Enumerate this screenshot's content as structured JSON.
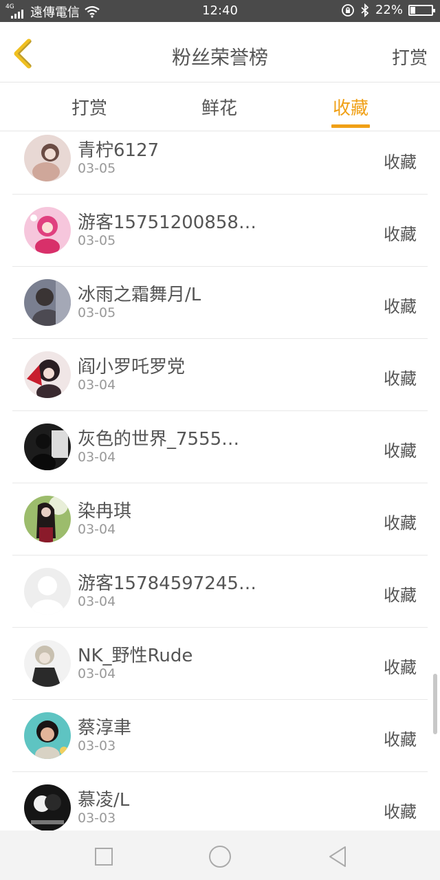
{
  "status_bar": {
    "network": "4G",
    "carrier": "遠傳電信",
    "time": "12:40",
    "battery_text": "22%",
    "battery_level": 0.22
  },
  "header": {
    "title": "粉丝荣誉榜",
    "right_label": "打赏"
  },
  "tabs": [
    {
      "label": "打赏",
      "active": false
    },
    {
      "label": "鲜花",
      "active": false
    },
    {
      "label": "收藏",
      "active": true
    }
  ],
  "colors": {
    "accent": "#f0a016",
    "text": "#555555",
    "subtext": "#999999",
    "status_bar": "#4a4a4a"
  },
  "fans": [
    {
      "name": "青柠6127",
      "date": "03-05",
      "action": "收藏"
    },
    {
      "name": "游客15751200858…",
      "date": "03-05",
      "action": "收藏"
    },
    {
      "name": "冰雨之霜舞月/L",
      "date": "03-05",
      "action": "收藏"
    },
    {
      "name": "阎小罗吒罗党",
      "date": "03-04",
      "action": "收藏"
    },
    {
      "name": "灰色的世界_7555…",
      "date": "03-04",
      "action": "收藏"
    },
    {
      "name": "染冉琪",
      "date": "03-04",
      "action": "收藏"
    },
    {
      "name": "游客15784597245…",
      "date": "03-04",
      "action": "收藏"
    },
    {
      "name": "NK_野性Rude",
      "date": "03-04",
      "action": "收藏"
    },
    {
      "name": "蔡淳聿",
      "date": "03-03",
      "action": "收藏"
    },
    {
      "name": "慕凌/L",
      "date": "03-03",
      "action": "收藏"
    }
  ]
}
